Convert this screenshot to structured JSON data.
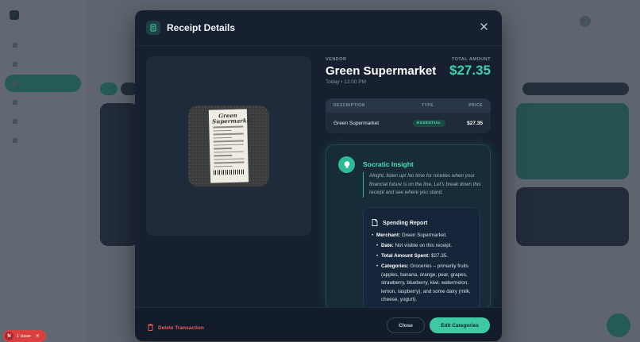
{
  "modal": {
    "title": "Receipt Details",
    "vendor_label": "VENDOR",
    "vendor_name": "Green Supermarket",
    "date": "Today • 12:00 PM",
    "total_label": "TOTAL AMOUNT",
    "total_amount": "$27.35",
    "table": {
      "headers": [
        "DESCRIPTION",
        "TYPE",
        "PRICE"
      ],
      "rows": [
        {
          "description": "Green Supermarket",
          "type": "ESSENTIAL",
          "price": "$27.35"
        }
      ]
    },
    "insight": {
      "title": "Socratic Insight",
      "quote": "Alright, listen up! No time for niceties when your financial future is on the line. Let's break down this receipt and see where you stand.",
      "report_title": "Spending Report",
      "items": [
        {
          "label": "Merchant:",
          "value": " Green Supermarket."
        },
        {
          "label": "Date:",
          "value": " Not visible on this receipt."
        },
        {
          "label": "Total Amount Spent:",
          "value": " $27.35."
        },
        {
          "label": "Categories:",
          "value": " Groceries – primarily fruits (apples, banana, orange, pear, grapes, strawberry, blueberry, kiwi, watermelon, lemon, raspberry), and some dairy (milk, cheese, yogurt)."
        }
      ]
    },
    "receipt_image_text": "Green Supermarket",
    "footer": {
      "delete_label": "Delete Transaction",
      "close_label": "Close",
      "edit_label": "Edit Categories"
    }
  },
  "issue_badge": {
    "avatar_letter": "N",
    "text": "1 Issue"
  },
  "colors": {
    "accent": "#3ed1a8",
    "danger": "#e85b5b",
    "modal_bg": "#162030"
  },
  "icons": {
    "header": "receipt-icon",
    "close": "close-icon",
    "insight": "lightbulb-icon",
    "report": "document-icon",
    "delete": "trash-icon"
  }
}
